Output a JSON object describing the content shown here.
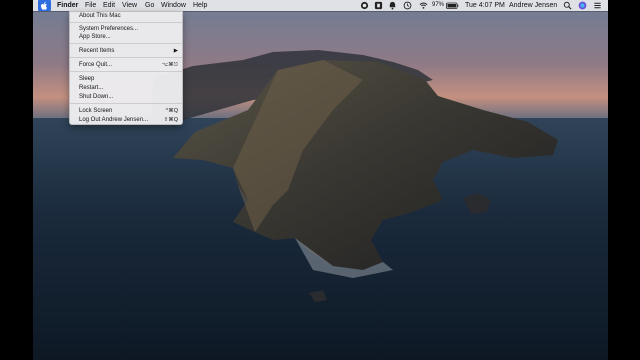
{
  "menubar": {
    "apple_icon": "apple-logo-icon",
    "app_name": "Finder",
    "menus": [
      "File",
      "Edit",
      "View",
      "Go",
      "Window",
      "Help"
    ],
    "battery_percent": "97%",
    "clock": "Tue 4:07 PM",
    "user_name": "Andrew Jensen",
    "status_icons": [
      "screen-recording-icon",
      "accessibility-icon",
      "notification-icon",
      "time-machine-icon",
      "wifi-icon",
      "battery-icon",
      "search-icon",
      "siri-icon",
      "control-center-icon"
    ]
  },
  "apple_menu": {
    "about": "About This Mac",
    "system_prefs": "System Preferences...",
    "app_store": "App Store...",
    "recent_items": "Recent Items",
    "recent_arrow": "▶",
    "force_quit": "Force Quit...",
    "force_quit_shortcut": "⌥⌘⎋",
    "sleep": "Sleep",
    "restart": "Restart...",
    "shut_down": "Shut Down...",
    "lock_screen": "Lock Screen",
    "lock_screen_shortcut": "^⌘Q",
    "log_out": "Log Out Andrew Jensen...",
    "log_out_shortcut": "⇧⌘Q"
  },
  "colors": {
    "menubar_bg": "#e8e8ec",
    "highlight": "#2f6fe0",
    "sky_top": "#6f7d96",
    "sunset": "#c49080",
    "water": "#142233"
  }
}
